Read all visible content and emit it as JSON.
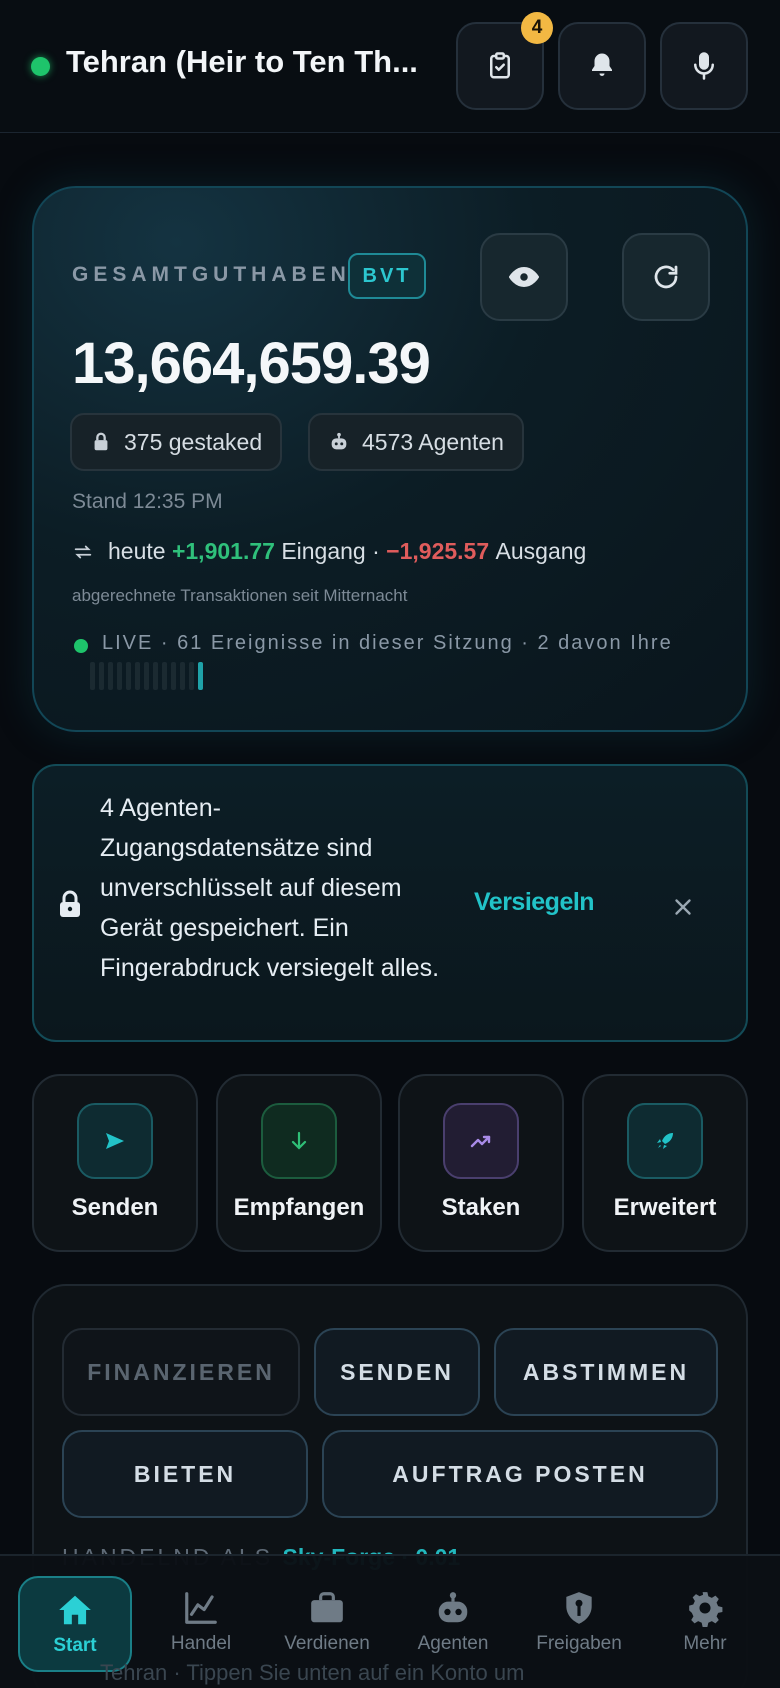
{
  "header": {
    "wallet_name": "Tehran (Heir to Ten Th...",
    "tasks_badge": "4",
    "icons": [
      "clipboard-check-icon",
      "bell-icon",
      "microphone-icon"
    ]
  },
  "balance": {
    "label": "GESAMTGUTHABEN",
    "currency": "BVT",
    "amount": "13,664,659.39",
    "staked_chip": "375 gestaked",
    "agents_chip": "4573 Agenten",
    "stand": "Stand 12:35 PM",
    "today_prefix": "heute",
    "incoming": "+1,901.77",
    "incoming_label": "Eingang ·",
    "outgoing": "−1,925.57",
    "outgoing_label": "Ausgang",
    "note": "abgerechnete Transaktionen seit Mitternacht",
    "live": "LIVE · 61 Ereignisse in dieser Sitzung · 2 davon Ihre"
  },
  "security": {
    "message": "4 Agenten-Zugangsdatensätze sind unverschlüsselt auf diesem Gerät gespeichert. Ein Fingerabdruck versiegelt alles.",
    "action": "Versiegeln"
  },
  "quick_actions": [
    {
      "label": "Senden",
      "icon": "send-icon",
      "color": "#1fb7bf"
    },
    {
      "label": "Empfangen",
      "icon": "arrow-down-icon",
      "color": "#2fbf77"
    },
    {
      "label": "Staken",
      "icon": "trending-up-icon",
      "color": "#a98be8"
    },
    {
      "label": "Erweitert",
      "icon": "rocket-icon",
      "color": "#1fb7bf"
    }
  ],
  "actions": {
    "fund": "FINANZIEREN",
    "send": "SENDEN",
    "vote": "ABSTIMMEN",
    "bid": "BIETEN",
    "post_order": "AUFTRAG POSTEN",
    "acting_as_label": "HANDELND ALS",
    "acting_as_value": "Sky-Forge · 0.01"
  },
  "nav": {
    "items": [
      "Start",
      "Handel",
      "Verdienen",
      "Agenten",
      "Freigaben",
      "Mehr"
    ],
    "active": "Start"
  },
  "footer_ghost": "Tehran · Tippen Sie unten auf ein Konto um"
}
